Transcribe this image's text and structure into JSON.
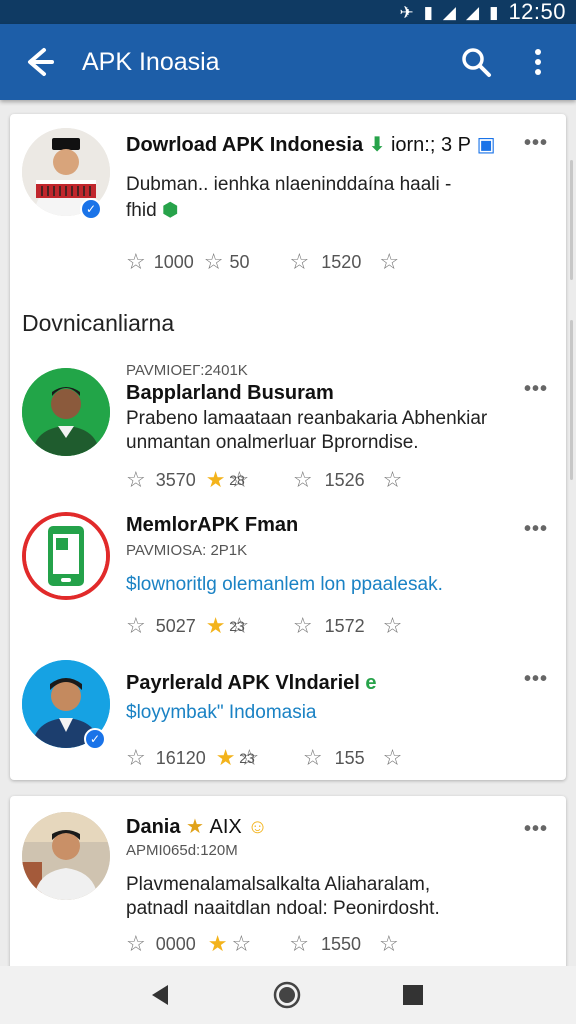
{
  "status_bar": {
    "time": "12:50"
  },
  "app_bar": {
    "title": "APK Inoasia",
    "back_icon": "back-arrow-icon",
    "search_icon": "search-icon",
    "menu_icon": "more-vert-icon"
  },
  "colors": {
    "app_bar": "#1d5ea8",
    "status_bar": "#0f3a63",
    "link": "#1a82c4",
    "star": "#f3b31b",
    "verified": "#1a73e8"
  },
  "featured_post": {
    "title": "Dowrload APK Indonesia",
    "title_suffix": "iorn:; 3 P",
    "text_line1": "Dubman.. ienhka nlaeninddaína haali -",
    "text_line2": "fhid",
    "stats": {
      "views": "1000",
      "stars": "50",
      "shares": "1520"
    }
  },
  "section": {
    "title": "Dovnicanliarna"
  },
  "posts": [
    {
      "meta": "PAVMIOEГ:2401K",
      "title": "Bapplarland Busuram",
      "text_line1": "Prabeno lamaataan reanbakaria Abhenkiar",
      "text_line2": "unmantan onalmerluar Bprorndise.",
      "stats": {
        "views": "3570",
        "stars": "28",
        "shares": "1526"
      }
    },
    {
      "title": "MemlorAPK Fman",
      "meta": "PAVMIOSA: 2P1K",
      "text_line1": "$lownoritlg olemanlem lon ppaalesak.",
      "stats": {
        "views": "5027",
        "stars": "23",
        "shares": "1572"
      }
    },
    {
      "title": "Payrlerald APK Vlndariel",
      "text_line1": "$loyymbak\" Indomasia",
      "stats": {
        "views": "16120",
        "stars": "23",
        "shares": "155"
      }
    }
  ],
  "bottom_post": {
    "title": "Dania",
    "title_suffix": "AIX",
    "meta": "APMI065d:120M",
    "text_line1": "Plavmenalamalsalkalta Aliaharalam,",
    "text_line2": "patnadl naaitdlan ndoal: Peonirdosht.",
    "stats": {
      "views": "0000",
      "stars": "",
      "shares": "1550"
    }
  }
}
